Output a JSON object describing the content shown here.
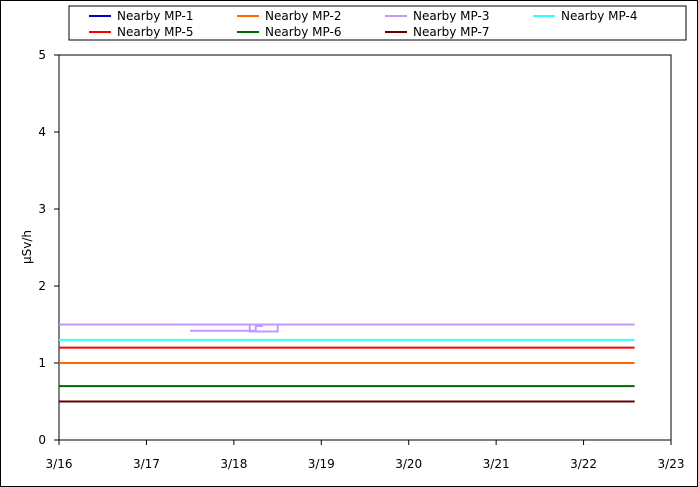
{
  "chart_data": {
    "type": "line",
    "ylabel": "μSv/h",
    "ylim": [
      0,
      5
    ],
    "yticks": [
      "0",
      "1",
      "2",
      "3",
      "4",
      "5"
    ],
    "xlim": [
      "3/16",
      "3/23"
    ],
    "xticks": [
      "3/16",
      "3/17",
      "3/18",
      "3/19",
      "3/20",
      "3/21",
      "3/22",
      "3/23"
    ],
    "grid": false,
    "legend_position": "top",
    "series": [
      {
        "name": "Nearby MP-1",
        "color": "#0000cc",
        "points": [
          [
            "3/17 12:00",
            1.5
          ],
          [
            "3/18 06:00",
            1.5
          ]
        ]
      },
      {
        "name": "Nearby MP-2",
        "color": "#ff6600",
        "points": [
          [
            "3/16 00:00",
            1.0
          ],
          [
            "3/22 14:00",
            1.0
          ]
        ]
      },
      {
        "name": "Nearby MP-3",
        "color": "#c299ff",
        "points": [
          [
            "3/16 00:00",
            1.5
          ],
          [
            "3/22 14:00",
            1.5
          ]
        ],
        "segment_points": [
          [
            "3/17 12:00",
            1.42
          ],
          [
            "3/18 06:00",
            1.42
          ],
          [
            "3/18 06:00",
            1.48
          ],
          [
            "3/18 08:00",
            1.48
          ]
        ]
      },
      {
        "name": "Nearby MP-4",
        "color": "#33ffff",
        "points": [
          [
            "3/16 00:00",
            1.3
          ],
          [
            "3/22 14:00",
            1.3
          ]
        ]
      },
      {
        "name": "Nearby MP-5",
        "color": "#ff0000",
        "points": [
          [
            "3/16 00:00",
            1.2
          ],
          [
            "3/22 14:00",
            1.2
          ]
        ]
      },
      {
        "name": "Nearby MP-6",
        "color": "#006600",
        "points": [
          [
            "3/16 00:00",
            0.7
          ],
          [
            "3/22 14:00",
            0.7
          ]
        ]
      },
      {
        "name": "Nearby MP-7",
        "color": "#660000",
        "points": [
          [
            "3/16 00:00",
            0.5
          ],
          [
            "3/22 14:00",
            0.5
          ]
        ]
      }
    ]
  }
}
